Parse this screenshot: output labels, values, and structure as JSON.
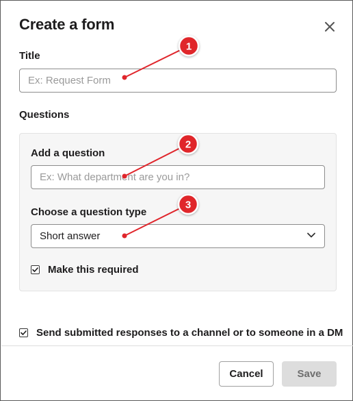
{
  "dialog": {
    "title": "Create a form",
    "close_icon": "close-icon"
  },
  "title_field": {
    "label": "Title",
    "placeholder": "Ex: Request Form"
  },
  "questions": {
    "heading": "Questions",
    "add_question": {
      "label": "Add a question",
      "placeholder": "Ex: What department are you in?"
    },
    "question_type": {
      "label": "Choose a question type",
      "selected": "Short answer",
      "icon": "chevron-down-icon"
    },
    "required": {
      "label": "Make this required",
      "checked": true
    }
  },
  "send_responses": {
    "label": "Send submitted responses to a channel or to someone in a DM",
    "checked": true
  },
  "footer": {
    "cancel_label": "Cancel",
    "save_label": "Save"
  },
  "annotations": {
    "color": "#e0262c",
    "badges": [
      "1",
      "2",
      "3"
    ]
  }
}
